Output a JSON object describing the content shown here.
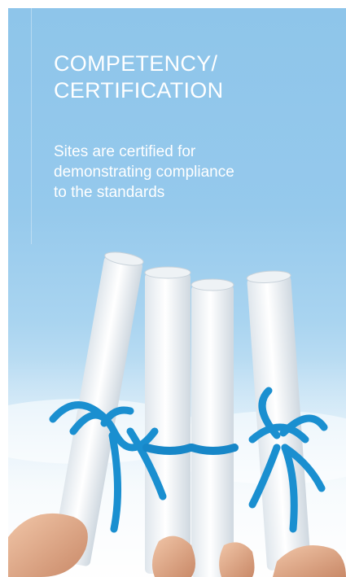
{
  "card": {
    "heading_line1": "COMPETENCY/",
    "heading_line2": "CERTIFICATION",
    "body_line1": "Sites are certified for",
    "body_line2": "demonstrating compliance",
    "body_line3": "to the standards"
  },
  "image": {
    "subject": "rolled-diplomas-with-blue-ribbons",
    "colors": {
      "sky": "#95c9ec",
      "ribbon": "#1a8fd0",
      "paper": "#f4f6f8",
      "skin": "#e8b596"
    }
  }
}
